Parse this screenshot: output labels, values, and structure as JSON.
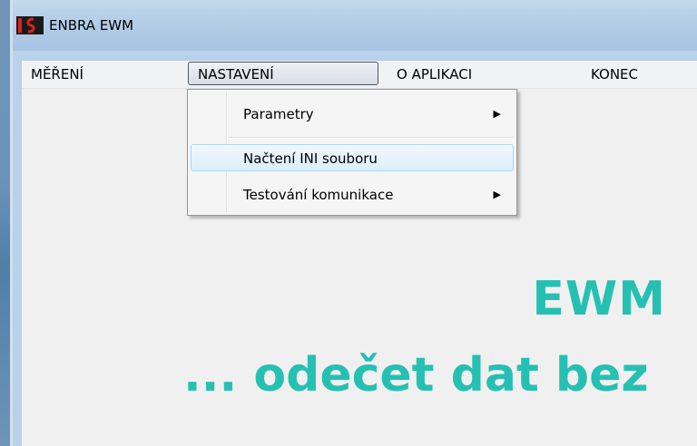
{
  "window": {
    "title": "ENBRA EWM",
    "logo_icon": "enbra-logo-icon"
  },
  "menubar": {
    "items": [
      {
        "label": "MĚŘENÍ"
      },
      {
        "label": "NASTAVENÍ"
      },
      {
        "label": "O APLIKACI"
      },
      {
        "label": "KONEC"
      }
    ],
    "active_index": 1
  },
  "dropdown": {
    "items": [
      {
        "label": "Parametry",
        "submenu": true,
        "arrow_icon": "chevron-right-icon"
      },
      {
        "label": "Načtení INI souboru",
        "submenu": false,
        "highlighted": true
      },
      {
        "label": "Testování komunikace",
        "submenu": true,
        "arrow_icon": "chevron-right-icon"
      }
    ]
  },
  "content": {
    "title": "EWM",
    "subtitle": "... odečet dat bez"
  },
  "colors": {
    "accent_text": "#26c0b3",
    "titlebar": "#b6cfe8",
    "menubar": "#f1f2f4",
    "content_bg": "#f0f0f0"
  }
}
